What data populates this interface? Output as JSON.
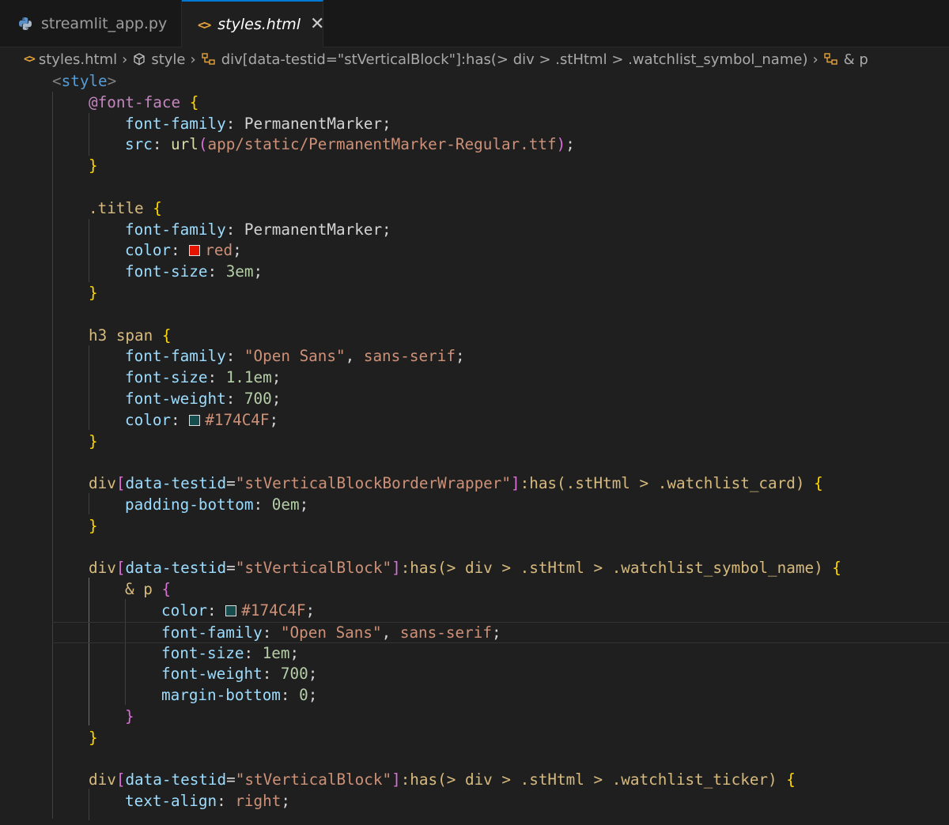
{
  "tabs": [
    {
      "label": "streamlit_app.py",
      "icon": "python-icon",
      "active": false
    },
    {
      "label": "styles.html",
      "icon": "code-icon",
      "active": true
    }
  ],
  "breadcrumb": {
    "file": "styles.html",
    "element": "style",
    "selector": "div[data-testid=\"stVerticalBlock\"]:has(> div > .stHtml > .watchlist_symbol_name)",
    "nested": "& p"
  },
  "colors": {
    "accent": "#0078d4",
    "red_swatch": "#e51400",
    "teal_swatch": "#174C4F"
  },
  "code": {
    "style_tag": "style",
    "font_face_rule": "@font-face",
    "font_face_family_prop": "font-family",
    "font_face_family_val": "PermanentMarker",
    "src_prop": "src",
    "src_fn": "url",
    "src_path": "app/static/PermanentMarker-Regular.ttf",
    "title_sel": ".title",
    "title_family_prop": "font-family",
    "title_family_val": "PermanentMarker",
    "title_color_prop": "color",
    "title_color_val": "red",
    "title_size_prop": "font-size",
    "title_size_val": "3em",
    "h3_sel": "h3 span",
    "h3_family_prop": "font-family",
    "h3_family_val": "\"Open Sans\"",
    "h3_family_val2": "sans-serif",
    "h3_size_prop": "font-size",
    "h3_size_val": "1.1em",
    "h3_weight_prop": "font-weight",
    "h3_weight_val": "700",
    "h3_color_prop": "color",
    "h3_color_val": "#174C4F",
    "wrap_tag": "div",
    "wrap_attr": "data-testid",
    "wrap_attr_val": "\"stVerticalBlockBorderWrapper\"",
    "wrap_rest": ":has(.stHtml > .watchlist_card)",
    "wrap_pad_prop": "padding-bottom",
    "wrap_pad_val": "0em",
    "vb_tag": "div",
    "vb_attr": "data-testid",
    "vb_attr_val": "\"stVerticalBlock\"",
    "vb_rest": ":has(> div > .stHtml > .watchlist_symbol_name)",
    "nested_sel": "& p",
    "p_color_prop": "color",
    "p_color_val": "#174C4F",
    "p_family_prop": "font-family",
    "p_family_val": "\"Open Sans\"",
    "p_family_val2": "sans-serif",
    "p_size_prop": "font-size",
    "p_size_val": "1em",
    "p_weight_prop": "font-weight",
    "p_weight_val": "700",
    "p_margin_prop": "margin-bottom",
    "p_margin_val": "0",
    "vb2_tag": "div",
    "vb2_attr": "data-testid",
    "vb2_attr_val": "\"stVerticalBlock\"",
    "vb2_rest": ":has(> div > .stHtml > .watchlist_ticker)",
    "ta_prop": "text-align",
    "ta_val": "right"
  }
}
